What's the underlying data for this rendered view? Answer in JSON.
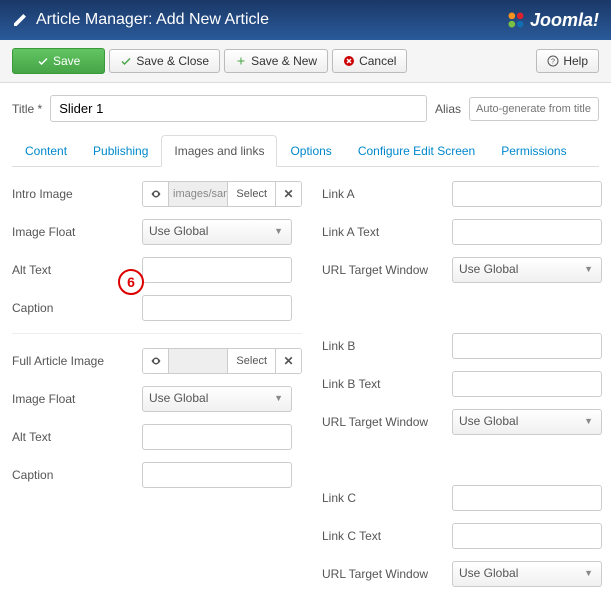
{
  "header": {
    "title": "Article Manager: Add New Article",
    "brand": "Joomla!"
  },
  "toolbar": {
    "save": "Save",
    "saveClose": "Save & Close",
    "saveNew": "Save & New",
    "cancel": "Cancel",
    "help": "Help"
  },
  "titleRow": {
    "titleLabel": "Title *",
    "titleValue": "Slider 1",
    "aliasLabel": "Alias",
    "aliasPlaceholder": "Auto-generate from title"
  },
  "tabs": [
    "Content",
    "Publishing",
    "Images and links",
    "Options",
    "Configure Edit Screen",
    "Permissions"
  ],
  "callout": "6",
  "left": {
    "introImage": {
      "label": "Intro Image",
      "path": "images/sample",
      "select": "Select"
    },
    "imageFloat1": {
      "label": "Image Float",
      "value": "Use Global"
    },
    "altText1": {
      "label": "Alt Text"
    },
    "caption1": {
      "label": "Caption"
    },
    "fullImage": {
      "label": "Full Article Image",
      "path": "",
      "select": "Select"
    },
    "imageFloat2": {
      "label": "Image Float",
      "value": "Use Global"
    },
    "altText2": {
      "label": "Alt Text"
    },
    "caption2": {
      "label": "Caption"
    }
  },
  "right": {
    "linkA": {
      "label": "Link A"
    },
    "linkAText": {
      "label": "Link A Text"
    },
    "urlTarget1": {
      "label": "URL Target Window",
      "value": "Use Global"
    },
    "linkB": {
      "label": "Link B"
    },
    "linkBText": {
      "label": "Link B Text"
    },
    "urlTarget2": {
      "label": "URL Target Window",
      "value": "Use Global"
    },
    "linkC": {
      "label": "Link C"
    },
    "linkCText": {
      "label": "Link C Text"
    },
    "urlTarget3": {
      "label": "URL Target Window",
      "value": "Use Global"
    }
  }
}
